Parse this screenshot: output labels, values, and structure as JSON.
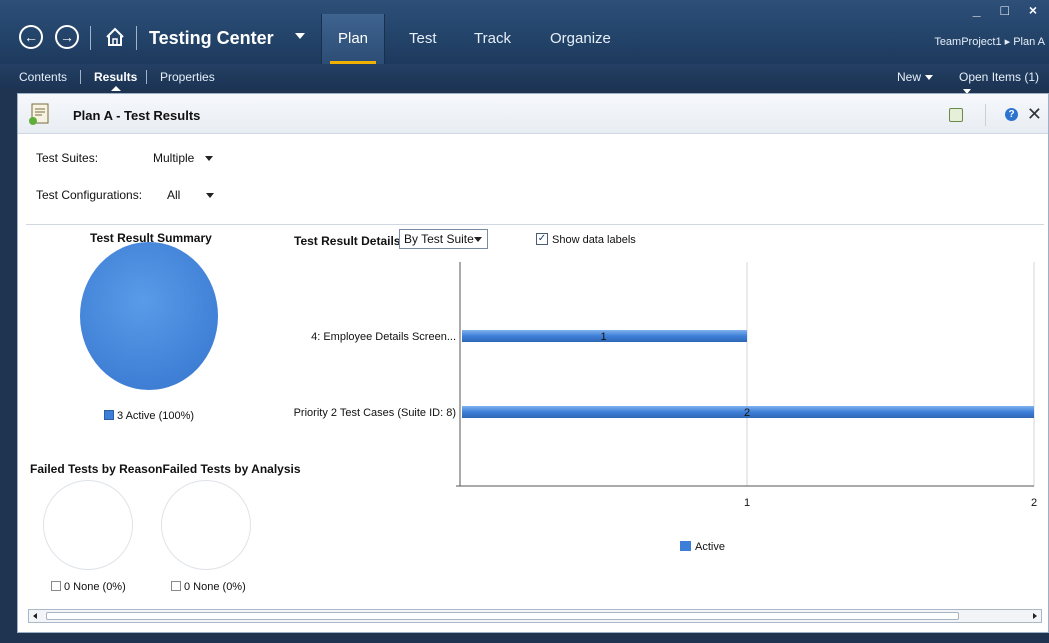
{
  "titlebar": {
    "app_title": "Testing Center",
    "tabs": [
      "Plan",
      "Test",
      "Track",
      "Organize"
    ],
    "active_tab": "Plan",
    "breadcrumb": "TeamProject1 ▸ Plan A",
    "window_controls": "_ □ ×"
  },
  "subbar": {
    "items": [
      "Contents",
      "Results",
      "Properties"
    ],
    "active": "Results",
    "new_label": "New",
    "open_items_label": "Open Items (1)"
  },
  "panel": {
    "title": "Plan A - Test Results",
    "filters": {
      "suites_label": "Test Suites:",
      "suites_value": "Multiple",
      "configs_label": "Test Configurations:",
      "configs_value": "All"
    },
    "summary": {
      "title": "Test Result Summary",
      "legend": "3 Active (100%)",
      "pie_color": "#3d7fd8"
    },
    "failed": {
      "title": "Failed Tests by ReasonFailed Tests by Analysis",
      "reason_legend": "0 None (0%)",
      "analysis_legend": "0 None (0%)"
    },
    "details": {
      "title": "Test Result Details",
      "group_by": "By Test Suite",
      "show_labels": "Show data labels",
      "show_labels_checked": true
    }
  },
  "chart_data": {
    "type": "bar",
    "orientation": "horizontal",
    "categories": [
      "4: Employee Details Screen...",
      "Priority 2 Test Cases (Suite ID: 8)"
    ],
    "series": [
      {
        "name": "Active",
        "values": [
          1,
          2
        ],
        "color": "#3d7fd8"
      }
    ],
    "xlim": [
      0,
      2
    ],
    "xticks": [
      "1",
      "2"
    ],
    "data_labels": [
      "1",
      "2"
    ],
    "legend": "bottom",
    "grid": true
  }
}
